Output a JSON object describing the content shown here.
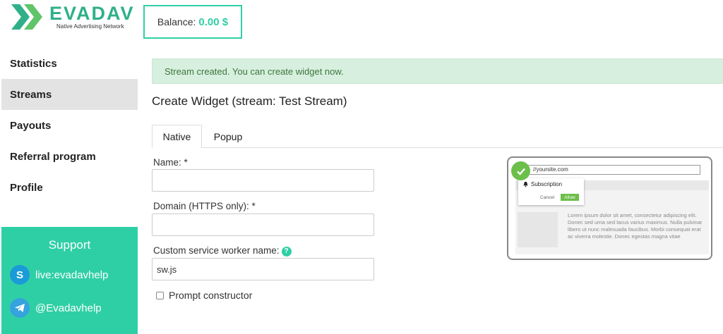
{
  "brand": {
    "name": "EVADAV",
    "tagline": "Native Advertising Network",
    "accent": "#2fcfa6"
  },
  "balance": {
    "label": "Balance:",
    "value": "0.00 $"
  },
  "sidebar": {
    "items": [
      {
        "label": "Statistics",
        "active": false
      },
      {
        "label": "Streams",
        "active": true
      },
      {
        "label": "Payouts",
        "active": false
      },
      {
        "label": "Referral program",
        "active": false
      },
      {
        "label": "Profile",
        "active": false
      }
    ],
    "support": {
      "title": "Support",
      "skype": "live:evadavhelp",
      "telegram": "@Evadavhelp"
    }
  },
  "main": {
    "alert": "Stream created. You can create widget now.",
    "title": "Create Widget (stream: Test Stream)",
    "tabs": [
      {
        "label": "Native"
      },
      {
        "label": "Popup"
      }
    ],
    "form": {
      "name_label": "Name: *",
      "name_value": "",
      "domain_label": "Domain (HTTPS only): *",
      "domain_value": "",
      "worker_label": "Custom service worker name:",
      "worker_help": "?",
      "worker_value": "sw.js",
      "prompt_label": "Prompt constructor"
    },
    "preview": {
      "url": "//yoursite.com",
      "subscription": "Subscription",
      "cancel": "Cancel",
      "allow": "Allow",
      "body_text": "Lorem ipsum dolor sit amet, consectetur adipiscing elit. Donec sed urna sed lacus varius maximus. Nulla pulvinar libero ut nunc malesuada faucibus. Morbi consequat erat ac viverra molestie. Donec egestas magna vitae"
    }
  }
}
